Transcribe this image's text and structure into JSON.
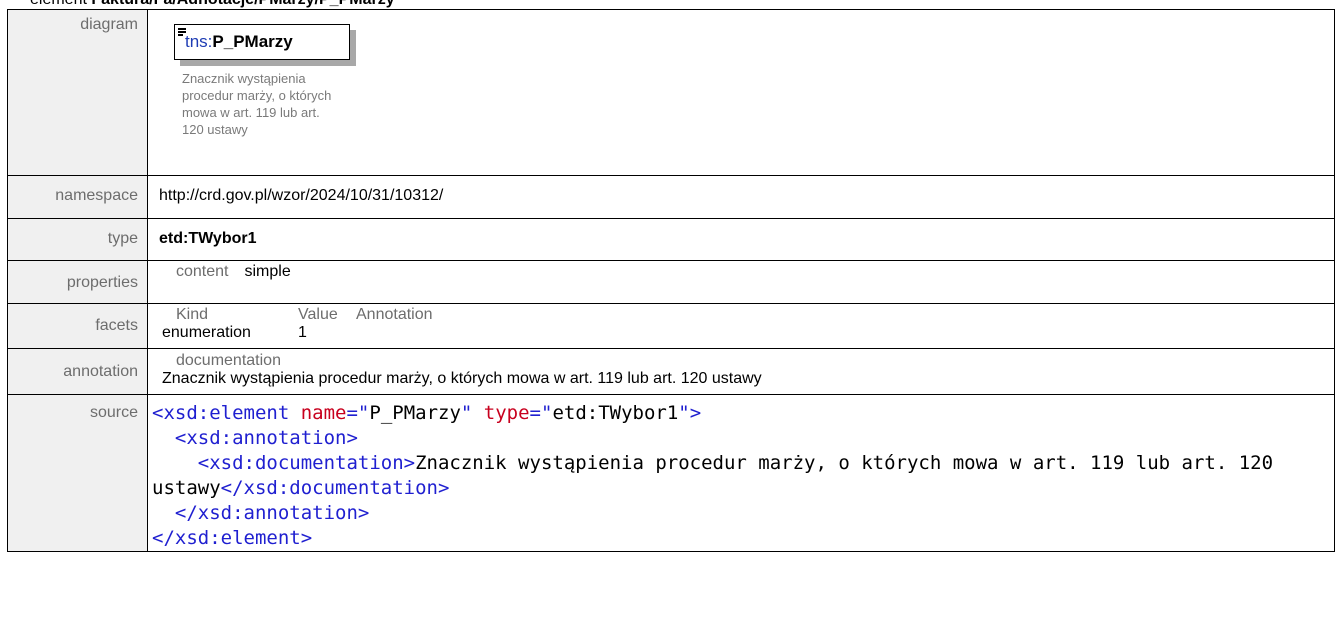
{
  "header": {
    "prefix": "element ",
    "path": "Faktura/Fa/Adnotacje/PMarzy/P_PMarzy"
  },
  "rows": {
    "diagram": {
      "label": "diagram",
      "element_prefix": "tns:",
      "element_name": "P_PMarzy",
      "element_icon": "lines-icon",
      "note": "Znacznik wystąpienia procedur marży, o których mowa w art. 119 lub art. 120 ustawy"
    },
    "namespace": {
      "label": "namespace",
      "value": "http://crd.gov.pl/wzor/2024/10/31/10312/"
    },
    "type": {
      "label": "type",
      "value": "etd:TWybor1"
    },
    "properties": {
      "label": "properties",
      "key": "content",
      "value": "simple"
    },
    "facets": {
      "label": "facets",
      "headers": [
        "Kind",
        "Value",
        "Annotation"
      ],
      "row": [
        "enumeration",
        "1",
        ""
      ]
    },
    "annotation": {
      "label": "annotation",
      "head": "documentation",
      "text": "Znacznik wystąpienia procedur marży, o których mowa w art. 119 lub art. 120 ustawy"
    },
    "source": {
      "label": "source",
      "lines": [
        {
          "indent": "",
          "parts": [
            [
              "tag",
              "<xsd:element "
            ],
            [
              "attr",
              "name"
            ],
            [
              "tag",
              "=\""
            ],
            [
              "val",
              "P_PMarzy"
            ],
            [
              "tag",
              "\" "
            ],
            [
              "attr",
              "type"
            ],
            [
              "tag",
              "=\""
            ],
            [
              "val",
              "etd:TWybor1"
            ],
            [
              "tag",
              "\">"
            ]
          ]
        },
        {
          "indent": "  ",
          "parts": [
            [
              "tag",
              "<xsd:annotation>"
            ]
          ]
        },
        {
          "indent": "    ",
          "parts": [
            [
              "tag",
              "<xsd:documentation>"
            ],
            [
              "val",
              "Znacznik wystąpienia procedur marży, o których mowa w art. 119 lub art. 120 ustawy"
            ],
            [
              "tag",
              "</xsd:documentation>"
            ]
          ]
        },
        {
          "indent": "  ",
          "parts": [
            [
              "tag",
              "</xsd:annotation>"
            ]
          ]
        },
        {
          "indent": "",
          "parts": [
            [
              "tag",
              "</xsd:element>"
            ]
          ]
        }
      ]
    }
  }
}
